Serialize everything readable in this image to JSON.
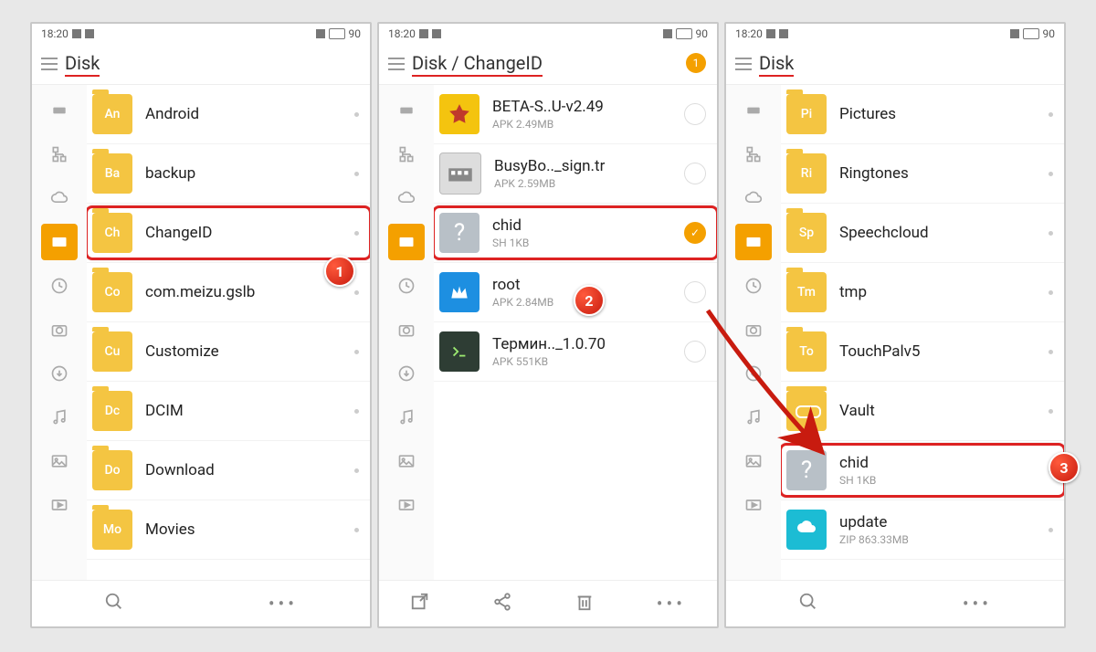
{
  "status": {
    "time": "18:20",
    "battery": "90"
  },
  "phone1": {
    "breadcrumb": "Disk",
    "list": [
      {
        "abbr": "An",
        "name": "Android"
      },
      {
        "abbr": "Ba",
        "name": "backup"
      },
      {
        "abbr": "Ch",
        "name": "ChangeID",
        "highlight": true
      },
      {
        "abbr": "Co",
        "name": "com.meizu.gslb"
      },
      {
        "abbr": "Cu",
        "name": "Customize"
      },
      {
        "abbr": "Dc",
        "name": "DCIM"
      },
      {
        "abbr": "Do",
        "name": "Download"
      },
      {
        "abbr": "Mo",
        "name": "Movies"
      }
    ]
  },
  "phone2": {
    "breadcrumb": "Disk / ChangeID",
    "badge": "1",
    "list": [
      {
        "type": "supersu",
        "name": "BETA-S..U-v2.49",
        "sub": "APK 2.49MB"
      },
      {
        "type": "busybox",
        "name": "BusyBo.._sign.tr",
        "sub": "APK 2.59MB"
      },
      {
        "type": "unknown",
        "name": "chid",
        "sub": "SH 1KB",
        "highlight": true,
        "checked": true
      },
      {
        "type": "kingroot",
        "name": "root",
        "sub": "APK 2.84MB"
      },
      {
        "type": "terminal",
        "name": "Термин.._1.0.70",
        "sub": "APK 551KB"
      }
    ]
  },
  "phone3": {
    "breadcrumb": "Disk",
    "list": [
      {
        "abbr": "Pi",
        "name": "Pictures"
      },
      {
        "abbr": "Ri",
        "name": "Ringtones"
      },
      {
        "abbr": "Sp",
        "name": "Speechcloud"
      },
      {
        "abbr": "Tm",
        "name": "tmp"
      },
      {
        "abbr": "To",
        "name": "TouchPalv5"
      },
      {
        "abbr": "",
        "name": "Vault",
        "vault": true
      },
      {
        "type": "unknown",
        "name": "chid",
        "sub": "SH 1KB",
        "highlight": true
      },
      {
        "type": "update",
        "name": "update",
        "sub": "ZIP 863.33MB"
      }
    ]
  },
  "steps": {
    "s1": "1",
    "s2": "2",
    "s3": "3"
  },
  "sidebar_names": [
    "usb",
    "network",
    "cloud",
    "storage",
    "recent",
    "camera",
    "downloads",
    "music",
    "images",
    "videos"
  ],
  "bottom": {
    "normal": [
      "search",
      "more"
    ],
    "select": [
      "move",
      "share",
      "delete",
      "more"
    ]
  }
}
